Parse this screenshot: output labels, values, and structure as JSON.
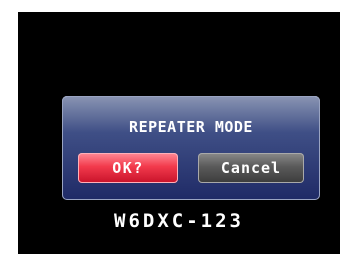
{
  "dialog": {
    "title": "REPEATER MODE",
    "ok_label": "OK?",
    "cancel_label": "Cancel"
  },
  "status": {
    "callsign": "W6DXC-123"
  },
  "colors": {
    "background": "#000000",
    "dialog_blue": "#2a3a7a",
    "ok_red": "#e8283e",
    "cancel_gray": "#555555",
    "text": "#ffffff"
  }
}
